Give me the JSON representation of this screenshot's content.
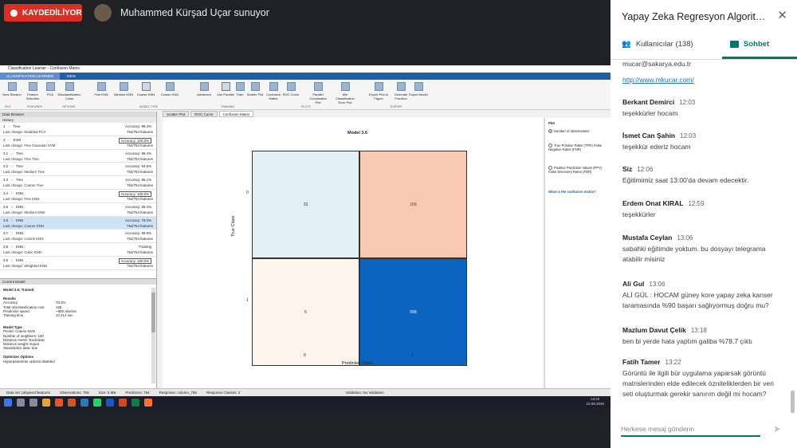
{
  "meeting": {
    "recording_label": "KAYDEDİLİYOR",
    "presenter_title": "Muhammed Kürşad Uçar sunuyor"
  },
  "matlab": {
    "window_title": "Classification Learner - Confusion Matrix",
    "tabs": [
      "CLASSIFICATION LEARNER",
      "VIEW"
    ],
    "ribbon_buttons": [
      "New Session",
      "Feature Selection",
      "PCA",
      "Misclassification Costs",
      "Fine KNN",
      "Medium KNN",
      "Coarse KNN",
      "Cosine KNN",
      "Advanced",
      "Use Parallel",
      "Train",
      "Scatter Plot",
      "Confusion Matrix",
      "ROC Curve",
      "Parallel Coordinates Plot",
      "Min Classification Error Plot",
      "Export Plot to Figure",
      "Generate Function",
      "Export Model"
    ],
    "ribbon_sections": [
      "FILE",
      "FEATURES",
      "OPTIONS",
      "MODEL TYPE",
      "TRAINING",
      "PLOTS",
      "EXPORT"
    ],
    "data_browser_title": "Data Browser",
    "history_title": "History",
    "models": [
      {
        "id": "1",
        "type": "Tree",
        "accuracy": "Accuracy: 98.4%",
        "change": "Last change: Disabled PCA",
        "features": "754/754 features",
        "boxed": false,
        "selected": false
      },
      {
        "id": "2",
        "type": "SVM",
        "accuracy": "Accuracy: 100.0%",
        "change": "Last change: Fine Gaussian SVM",
        "features": "754/754 features",
        "boxed": true,
        "selected": false
      },
      {
        "id": "3.1",
        "type": "Tree",
        "accuracy": "Accuracy: 98.4%",
        "change": "Last change: Fine Tree",
        "features": "754/754 features",
        "boxed": false,
        "selected": false
      },
      {
        "id": "3.2",
        "type": "Tree",
        "accuracy": "Accuracy: 94.6%",
        "change": "Last change: Medium Tree",
        "features": "754/754 features",
        "boxed": false,
        "selected": false
      },
      {
        "id": "3.3",
        "type": "Tree",
        "accuracy": "Accuracy: 85.1%",
        "change": "Last change: Coarse Tree",
        "features": "754/754 features",
        "boxed": false,
        "selected": false
      },
      {
        "id": "3.4",
        "type": "KNN",
        "accuracy": "Accuracy: 100.0%",
        "change": "Last change: Fine KNN",
        "features": "754/754 features",
        "boxed": true,
        "selected": false
      },
      {
        "id": "3.5",
        "type": "KNN",
        "accuracy": "Accuracy: 88.4%",
        "change": "Last change: Medium KNN",
        "features": "754/754 features",
        "boxed": false,
        "selected": false
      },
      {
        "id": "3.6",
        "type": "KNN",
        "accuracy": "Accuracy: 78.2%",
        "change": "Last change: Coarse KNN",
        "features": "754/754 features",
        "boxed": false,
        "selected": true
      },
      {
        "id": "3.7",
        "type": "KNN",
        "accuracy": "Accuracy: 89.8%",
        "change": "Last change: Cosine KNN",
        "features": "754/754 features",
        "boxed": false,
        "selected": false
      },
      {
        "id": "3.8",
        "type": "KNN",
        "accuracy": "Training",
        "change": "Last change: Cubic KNN",
        "features": "754/754 features",
        "boxed": false,
        "selected": false
      },
      {
        "id": "3.9",
        "type": "KNN",
        "accuracy": "Accuracy: 100.0%",
        "change": "Last change: Weighted KNN",
        "features": "754/754 features",
        "boxed": true,
        "selected": false
      }
    ],
    "current_model": {
      "header": "Current Model",
      "title": "Model 3.6: Trained",
      "results_label": "Results",
      "results": [
        {
          "k": "Accuracy",
          "v": "78.2%"
        },
        {
          "k": "Total misclassification cost",
          "v": "165"
        },
        {
          "k": "Prediction speed",
          "v": "~800 obs/sec"
        },
        {
          "k": "Training time",
          "v": "10.212 sec"
        }
      ],
      "model_type_label": "Model Type",
      "model_type": [
        "Preset: Coarse KNN",
        "Number of neighbors: 100",
        "Distance metric: Euclidean",
        "Distance weight: Equal",
        "Standardize data: true"
      ],
      "optimizer_label": "Optimizer Options",
      "optimizer": "Hyperparameter options disabled"
    },
    "doc_tabs": [
      "Scatter Plot",
      "ROC Curve",
      "Confusion Matrix"
    ],
    "plot_options": {
      "title": "Plot",
      "options": [
        "Number of observations",
        "True Positive Rates (TPR) False Negative Rates (FNR)",
        "Positive Predictive Values (PPV) False Discovery Rates (FDR)"
      ],
      "link": "What is the confusion matrix?"
    },
    "status": {
      "dataset": "Data set: pdspeechfeatures",
      "observations": "Observations: 756",
      "size": "Size: 5 MB",
      "predictors": "Predictors: 754",
      "response": "Response: column_755",
      "classes": "Response Classes: 2",
      "validation": "Validation: No Validation"
    },
    "clock": {
      "time": "13:22",
      "date": "10.09.2020"
    }
  },
  "chart_data": {
    "type": "heatmap",
    "title": "Model 3.6",
    "xlabel": "Predicted Class",
    "ylabel": "True Class",
    "x_categories": [
      "0",
      "1"
    ],
    "y_categories": [
      "0",
      "1"
    ],
    "values": [
      [
        33,
        159
      ],
      [
        6,
        558
      ]
    ],
    "colors": [
      [
        "#e3f0f8",
        "#f6c9b3"
      ],
      [
        "#fdf4ec",
        "#0b65c0"
      ]
    ]
  },
  "chat": {
    "title": "Yapay Zeka Regresyon Algoritmal...",
    "users_tab": "Kullanıcılar (138)",
    "chat_tab": "Sohbet",
    "accent": "#00796b",
    "messages": [
      {
        "who": "",
        "time": "",
        "text": "mucar@sakarya.edu.tr",
        "link": "http://www.mkucar.com/"
      },
      {
        "who": "Berkant Demirci",
        "time": "12:03",
        "text": "teşekkürler hocam"
      },
      {
        "who": "İsmet Can Şahin",
        "time": "12:03",
        "text": "teşekkür ederiz hocam"
      },
      {
        "who": "Siz",
        "time": "12:06",
        "text": "Eğitimimiz saat 13:00'da devam edecektir."
      },
      {
        "who": "Erdem Onat KIRAL",
        "time": "12:59",
        "text": "teşekkürler"
      },
      {
        "who": "Mustafa Ceylan",
        "time": "13:06",
        "text": "sabahki eğitimde yoktum. bu dosyayı telegrama atabilir misiniz"
      },
      {
        "who": "Ali Gul",
        "time": "13:06",
        "text": "ALİ GÜL : HOCAM güney kore yapay zeka kanser taramasında %90 başarı sağlıyormuş doğru mu?"
      },
      {
        "who": "Mazlum Davut Çelik",
        "time": "13:18",
        "text": "ben bi yerde hata yaptım galiba  %78.7 çıktı"
      },
      {
        "who": "Fatih Tamer",
        "time": "13:22",
        "text": "Görüntü ile ilgili bür uygulama  yaparsak görüntü matrislerinden elde edilecek özniteliklerden bir veri seti oluşturmak gerekir sanırım değil mi hocam?"
      }
    ],
    "input_placeholder": "Herkese mesaj gönderin"
  }
}
